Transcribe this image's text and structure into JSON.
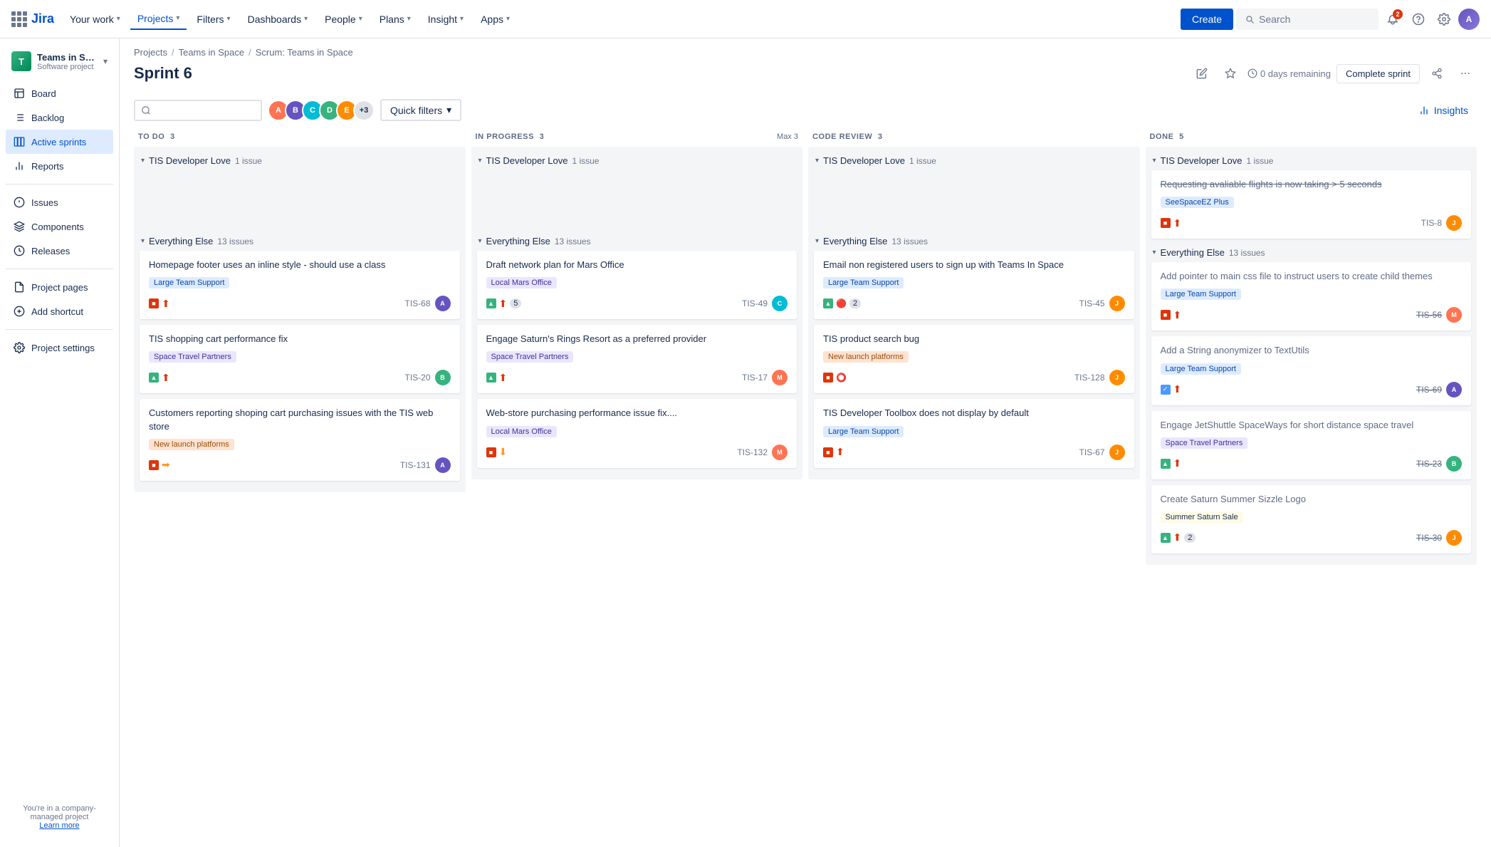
{
  "topnav": {
    "logo_text": "Jira",
    "your_work": "Your work",
    "projects": "Projects",
    "filters": "Filters",
    "dashboards": "Dashboards",
    "people": "People",
    "plans": "Plans",
    "insight": "Insight",
    "apps": "Apps",
    "create": "Create",
    "search_placeholder": "Search",
    "notif_count": "2"
  },
  "sidebar": {
    "project_name": "Teams in Space",
    "project_type": "Software project",
    "project_initials": "T",
    "nav_items": [
      {
        "id": "board",
        "label": "Board",
        "active": false
      },
      {
        "id": "backlog",
        "label": "Backlog",
        "active": false
      },
      {
        "id": "active-sprints",
        "label": "Active sprints",
        "active": true
      },
      {
        "id": "reports",
        "label": "Reports",
        "active": false
      },
      {
        "id": "issues",
        "label": "Issues",
        "active": false
      },
      {
        "id": "components",
        "label": "Components",
        "active": false
      },
      {
        "id": "releases",
        "label": "Releases",
        "active": false
      },
      {
        "id": "project-pages",
        "label": "Project pages",
        "active": false
      },
      {
        "id": "add-shortcut",
        "label": "Add shortcut",
        "active": false
      },
      {
        "id": "project-settings",
        "label": "Project settings",
        "active": false
      }
    ],
    "footer_text": "You're in a company-managed project",
    "learn_more": "Learn more"
  },
  "breadcrumb": {
    "items": [
      "Projects",
      "Teams in Space",
      "Scrum: Teams in Space"
    ]
  },
  "page": {
    "title": "Sprint 6",
    "days_remaining": "0 days remaining",
    "complete_sprint": "Complete sprint"
  },
  "toolbar": {
    "quick_filters": "Quick filters",
    "insights": "Insights",
    "avatar_count": "+3"
  },
  "board": {
    "columns": [
      {
        "id": "todo",
        "title": "TO DO",
        "count": "3",
        "max": null
      },
      {
        "id": "inprogress",
        "title": "IN PROGRESS",
        "count": "3",
        "max": "Max 3"
      },
      {
        "id": "codereview",
        "title": "CODE REVIEW",
        "count": "3",
        "max": null
      },
      {
        "id": "done",
        "title": "DONE",
        "count": "5",
        "max": null
      }
    ],
    "sprint_sections": [
      {
        "id": "developer-love",
        "name": "TIS Developer Love",
        "count": "1 issue",
        "cards": {
          "todo": [],
          "inprogress": [],
          "codereview": [],
          "done": [
            {
              "title": "Requesting avaliable flights is now taking > 5 seconds",
              "label": "SeeSpaceEZ Plus",
              "label_class": "label-blue",
              "type": "bug",
              "priority": "high",
              "id": "TIS-8",
              "avatar_color": "#FF8B00",
              "avatar_initials": "JD",
              "count": null,
              "done": true
            }
          ]
        }
      },
      {
        "id": "everything-else",
        "name": "Everything Else",
        "count": "13 issues",
        "cards": {
          "todo": [
            {
              "title": "Homepage footer uses an inline style - should use a class",
              "label": "Large Team Support",
              "label_class": "label-blue",
              "type": "bug",
              "priority": "high",
              "id": "TIS-68",
              "avatar_color": "#6554c0",
              "avatar_initials": "AL",
              "count": null,
              "done": false
            },
            {
              "title": "TIS shopping cart performance fix",
              "label": "Space Travel Partners",
              "label_class": "label-purple",
              "type": "story",
              "priority": "high",
              "id": "TIS-20",
              "avatar_color": "#36b37e",
              "avatar_initials": "BM",
              "count": null,
              "done": false
            },
            {
              "title": "Customers reporting shoping cart purchasing issues with the TIS web store",
              "label": "New launch platforms",
              "label_class": "label-orange",
              "type": "bug",
              "priority": "med",
              "id": "TIS-131",
              "avatar_color": "#6554c0",
              "avatar_initials": "AL",
              "count": null,
              "done": false
            }
          ],
          "inprogress": [
            {
              "title": "Draft network plan for Mars Office",
              "label": "Local Mars Office",
              "label_class": "label-purple",
              "type": "story",
              "priority": "high",
              "id": "TIS-49",
              "avatar_color": "#00bcd4",
              "avatar_initials": "TC",
              "count": "5",
              "done": false
            },
            {
              "title": "Engage Saturn's Rings Resort as a preferred provider",
              "label": "Space Travel Partners",
              "label_class": "label-purple",
              "type": "story",
              "priority": "high",
              "id": "TIS-17",
              "avatar_color": "#ff7452",
              "avatar_initials": "MR",
              "count": null,
              "done": false
            },
            {
              "title": "Web-store purchasing performance issue fix....",
              "label": "Local Mars Office",
              "label_class": "label-purple",
              "type": "bug",
              "priority": "med",
              "id": "TIS-132",
              "avatar_color": "#ff7452",
              "avatar_initials": "MR",
              "count": null,
              "done": false
            }
          ],
          "codereview": [
            {
              "title": "Email non registered users to sign up with Teams In Space",
              "label": "Large Team Support",
              "label_class": "label-blue",
              "type": "story",
              "priority": "med",
              "id": "TIS-45",
              "avatar_color": "#FF8B00",
              "avatar_initials": "JD",
              "count": "2",
              "done": false
            },
            {
              "title": "TIS product search bug",
              "label": "New launch platforms",
              "label_class": "label-orange",
              "type": "bug",
              "priority": "med",
              "id": "TIS-128",
              "avatar_color": "#FF8B00",
              "avatar_initials": "JD",
              "count": null,
              "done": false
            },
            {
              "title": "TIS Developer Toolbox does not display by default",
              "label": "Large Team Support",
              "label_class": "label-blue",
              "type": "bug",
              "priority": "high",
              "id": "TIS-67",
              "avatar_color": "#FF8B00",
              "avatar_initials": "JD",
              "count": null,
              "done": false
            }
          ],
          "done": [
            {
              "title": "Add pointer to main css file to instruct users to create child themes",
              "label": "Large Team Support",
              "label_class": "label-blue",
              "type": "bug",
              "priority": "high",
              "id": "TIS-56",
              "avatar_color": "#ff7452",
              "avatar_initials": "MR",
              "count": null,
              "done": true
            },
            {
              "title": "Add a String anonymizer to TextUtils",
              "label": "Large Team Support",
              "label_class": "label-blue",
              "type": "task",
              "priority": "high",
              "id": "TIS-69",
              "avatar_color": "#6554c0",
              "avatar_initials": "AL",
              "count": null,
              "done": true
            },
            {
              "title": "Engage JetShuttle SpaceWays for short distance space travel",
              "label": "Space Travel Partners",
              "label_class": "label-purple",
              "type": "story",
              "priority": "high",
              "id": "TIS-23",
              "avatar_color": "#36b37e",
              "avatar_initials": "BM",
              "count": null,
              "done": true
            },
            {
              "title": "Create Saturn Summer Sizzle Logo",
              "label": "Summer Saturn Sale",
              "label_class": "label-yellow",
              "type": "story",
              "priority": "high",
              "id": "TIS-30",
              "avatar_color": "#FF8B00",
              "avatar_initials": "JD",
              "count": "2",
              "done": true
            }
          ]
        }
      }
    ]
  }
}
